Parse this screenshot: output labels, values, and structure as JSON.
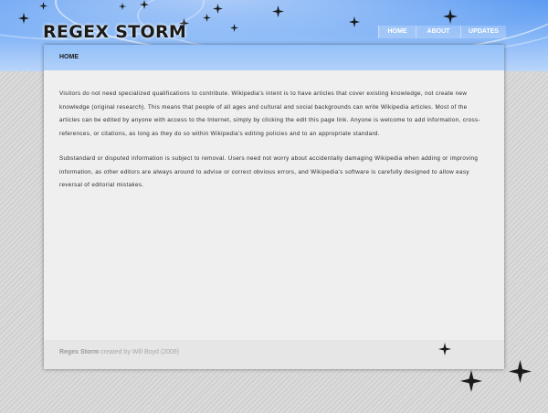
{
  "site": {
    "title": "REGEX STORM"
  },
  "nav": {
    "items": [
      {
        "label": "HOME"
      },
      {
        "label": "ABOUT"
      },
      {
        "label": "UPDATES"
      }
    ]
  },
  "breadcrumb": {
    "current": "HOME"
  },
  "content": {
    "paragraphs": [
      "Visitors do not need specialized qualifications to contribute. Wikipedia's intent is to have articles that cover existing knowledge, not create new knowledge (original research). This means that people of all ages and cultural and social backgrounds can write Wikipedia articles. Most of the articles can be edited by anyone with access to the Internet, simply by clicking the edit this page link. Anyone is welcome to add information, cross-references, or citations, as long as they do so within Wikipedia's editing policies and to an appropriate standard.",
      "Substandard or disputed information is subject to removal. Users need not worry about accidentally damaging Wikipedia when adding or improving information, as other editors are always around to advise or correct obvious errors, and Wikipedia's software is carefully designed to allow easy reversal of editorial mistakes."
    ]
  },
  "footer": {
    "brand": "Regex Storm",
    "credit": " created by Will Boyd (2009)"
  },
  "colors": {
    "header_blue": "#6aa6f4",
    "panel_bg": "#efefef",
    "page_bg": "#d4d4d4"
  }
}
